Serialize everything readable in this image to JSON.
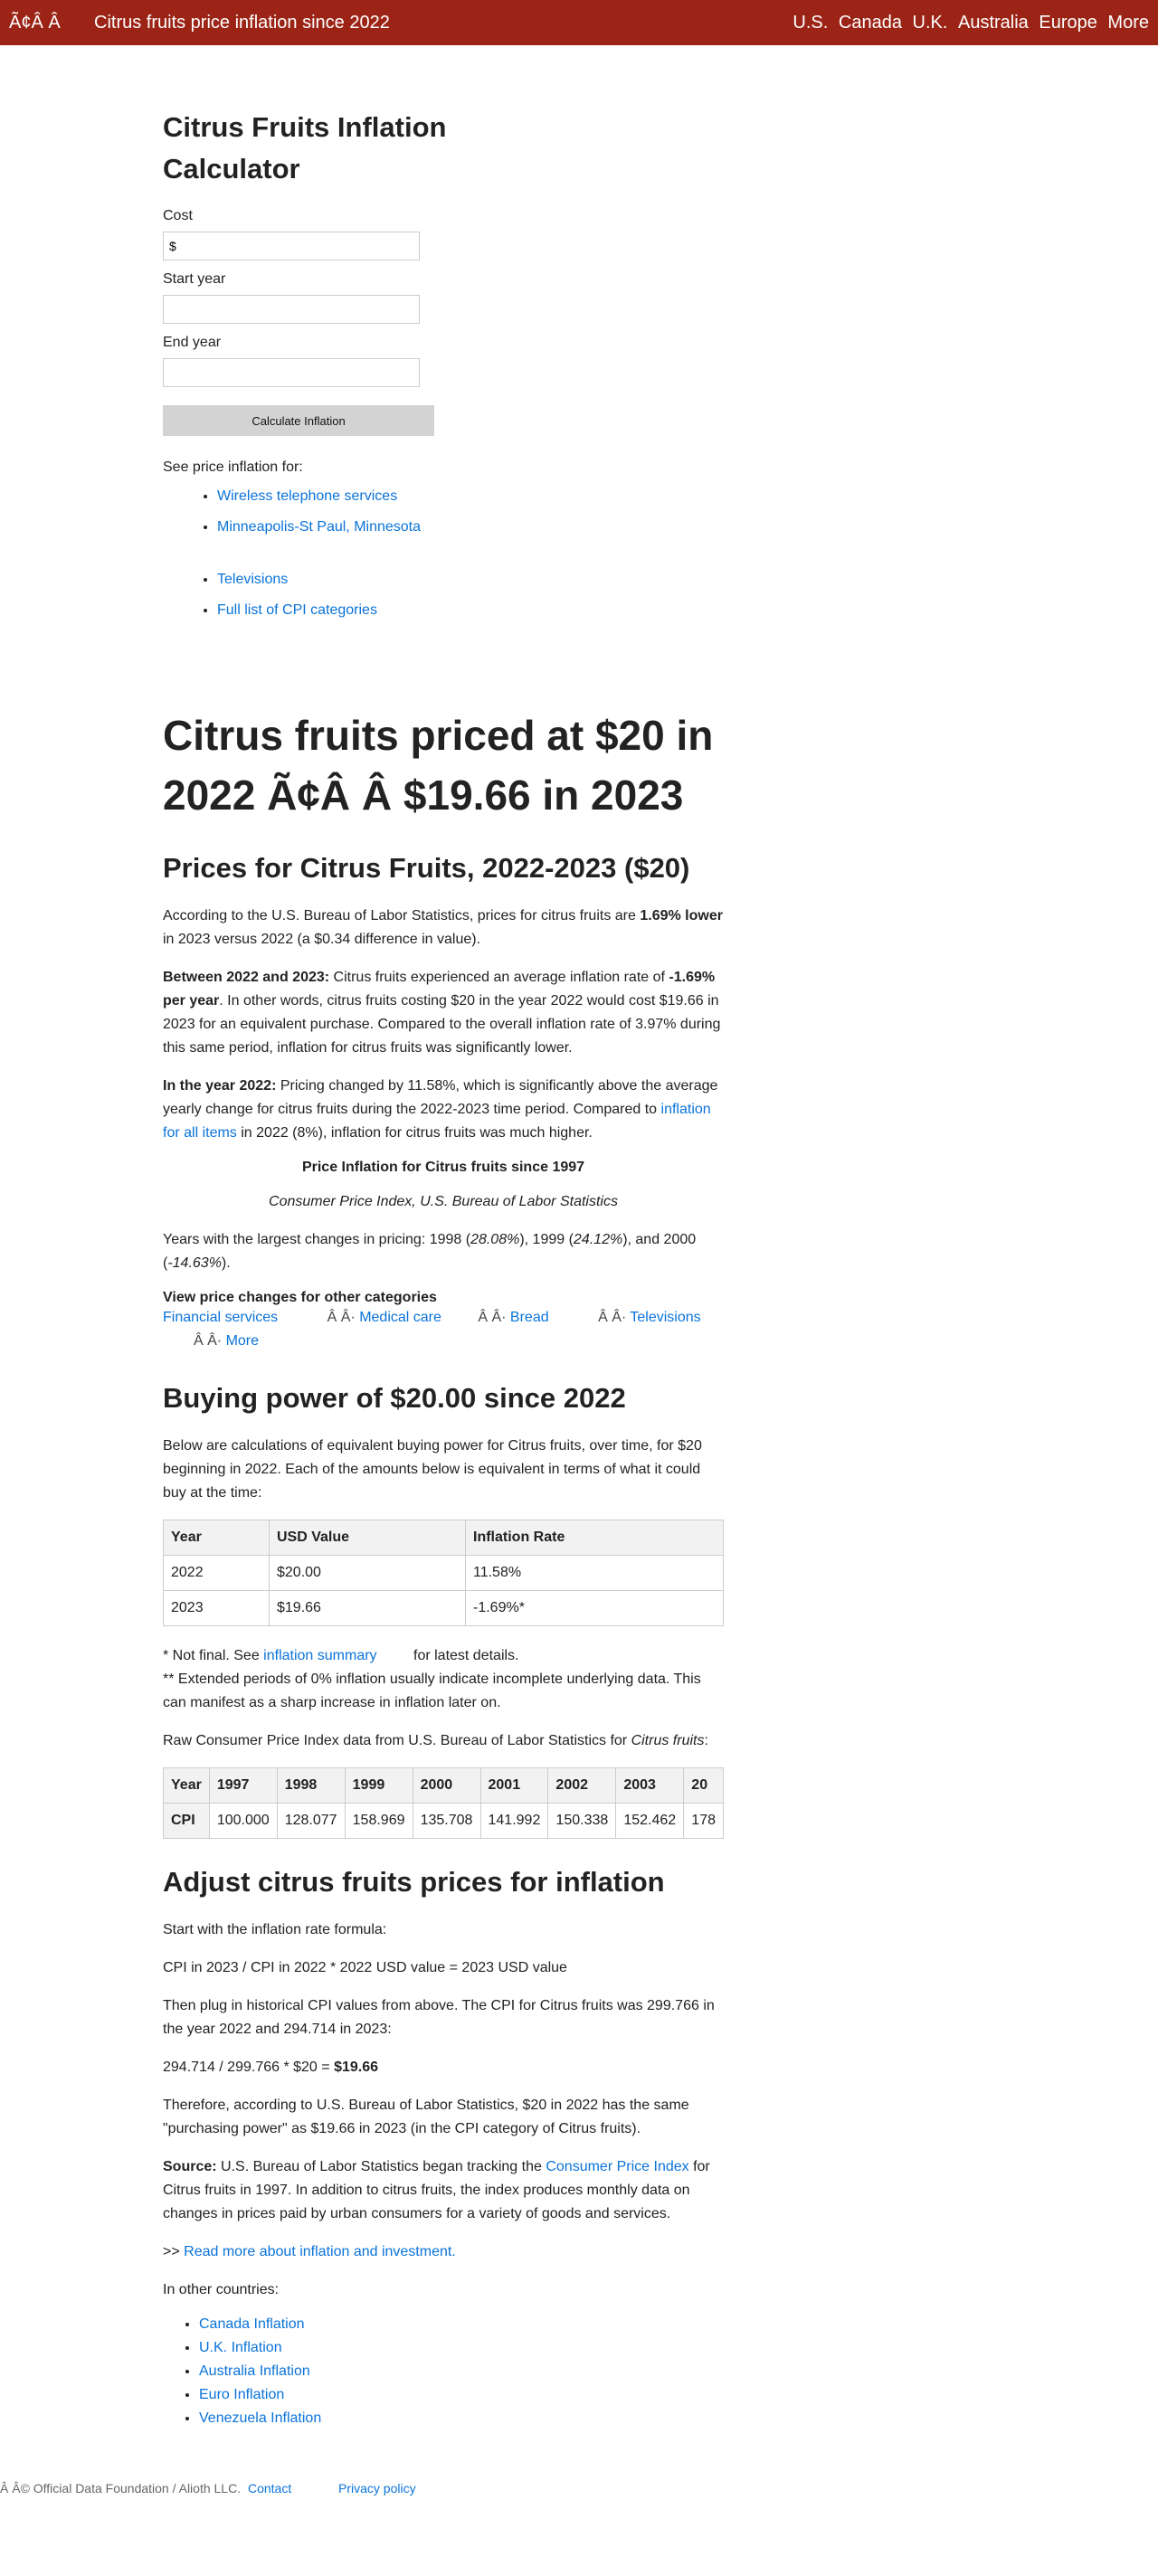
{
  "header": {
    "brand": "Ã¢Â Â",
    "title": "Citrus fruits price inflation since 2022",
    "nav": [
      "U.S.",
      "Canada",
      "U.K.",
      "Australia",
      "Europe",
      "More"
    ]
  },
  "calculator": {
    "title": "Citrus Fruits Inflation Calculator",
    "cost_label": "Cost",
    "cost_value": "$",
    "start_label": "Start year",
    "start_value": "",
    "end_label": "End year",
    "end_value": "",
    "button": "Calculate Inflation",
    "see_text": "See price inflation for:",
    "links_a": [
      "Wireless telephone services",
      "Minneapolis-St Paul, Minnesota"
    ],
    "links_b": [
      "Televisions",
      "Full list of CPI categories"
    ]
  },
  "article": {
    "headline": "Citrus fruits priced at $20 in 2022 Ã¢Â Â $19.66 in 2023",
    "prices_heading": "Prices for Citrus Fruits, 2022-2023 ($20)",
    "p1_pre": "According to the U.S. Bureau of Labor Statistics, prices for citrus fruits are ",
    "p1_bold": "1.69% lower",
    "p1_post": " in 2023 versus 2022 (a $0.34 difference in value).",
    "p2_bold1": "Between 2022 and 2023:",
    "p2_mid": " Citrus fruits experienced an average inflation rate of ",
    "p2_bold2": "-1.69% per year",
    "p2_post": ". In other words, citrus fruits costing $20 in the year 2022 would cost $19.66 in 2023 for an equivalent purchase. Compared to the overall inflation rate of 3.97% during this same period, inflation for citrus fruits was significantly lower.",
    "p3_bold": "In the year 2022:",
    "p3_mid": " Pricing changed by 11.58%, which is significantly above the average yearly change for citrus fruits during the 2022-2023 time period. Compared to ",
    "p3_link": "inflation for all items",
    "p3_post": " in 2022 (8%), inflation for citrus fruits was much higher.",
    "chart_title": "Price Inflation for Citrus fruits since 1997",
    "chart_subtitle": "Consumer Price Index, U.S. Bureau of Labor Statistics",
    "largest_pre": "Years with the largest changes in pricing: 1998 (",
    "largest_v1": "28.08%",
    "largest_mid1": "), 1999 (",
    "largest_v2": "24.12%",
    "largest_mid2": "), and 2000 (",
    "largest_v3": "-14.63%",
    "largest_post": ").",
    "view_title": "View price changes for other categories",
    "view_sep": "Â Â·",
    "view_links": [
      "Financial services",
      "Medical care",
      "Bread",
      "Televisions",
      "More"
    ]
  },
  "buying_power": {
    "heading": "Buying power of $20.00 since 2022",
    "intro": "Below are calculations of equivalent buying power for Citrus fruits, over time, for $20 beginning in 2022. Each of the amounts below is equivalent in terms of what it could buy at the time:",
    "columns": [
      "Year",
      "USD Value",
      "Inflation Rate"
    ],
    "rows": [
      [
        "2022",
        "$20.00",
        "11.58%"
      ],
      [
        "2023",
        "$19.66",
        "-1.69%*"
      ]
    ],
    "note1_pre": "* Not final. See ",
    "note1_link": "inflation summary",
    "note1_post": " for latest details.",
    "note2": "** Extended periods of 0% inflation usually indicate incomplete underlying data. This can manifest as a sharp increase in inflation later on.",
    "raw_pre": "Raw Consumer Price Index data from U.S. Bureau of Labor Statistics for ",
    "raw_ital": "Citrus fruits",
    "raw_post": ":",
    "raw_header": [
      "Year",
      "1997",
      "1998",
      "1999",
      "2000",
      "2001",
      "2002",
      "2003",
      "20"
    ],
    "raw_row": [
      "CPI",
      "100.000",
      "128.077",
      "158.969",
      "135.708",
      "141.992",
      "150.338",
      "152.462",
      "178"
    ]
  },
  "adjust": {
    "heading": "Adjust citrus fruits prices for inflation",
    "p1": "Start with the inflation rate formula:",
    "formula": "CPI in 2023 / CPI in 2022 * 2022 USD value = 2023 USD value",
    "p2": "Then plug in historical CPI values from above. The CPI for Citrus fruits was 299.766 in the year 2022 and 294.714 in 2023:",
    "calc_pre": "294.714 / 299.766 * $20 = ",
    "calc_bold": "$19.66",
    "p3": "Therefore, according to U.S. Bureau of Labor Statistics, $20 in 2022 has the same \"purchasing power\" as $19.66 in 2023 (in the CPI category of Citrus fruits).",
    "src_bold": "Source:",
    "src_mid": " U.S. Bureau of Labor Statistics began tracking the ",
    "src_link": "Consumer Price Index",
    "src_post": " for Citrus fruits in 1997. In addition to citrus fruits, the index produces monthly data on changes in prices paid by urban consumers for a variety of goods and services.",
    "readmore_pre": ">> ",
    "readmore_link": "Read more about inflation and investment.",
    "other_label": "In other countries:",
    "countries": [
      "Canada Inflation",
      "U.K. Inflation",
      "Australia Inflation",
      "Euro Inflation",
      "Venezuela Inflation"
    ]
  },
  "footer": {
    "copyright": "Â Â© Official Data Foundation / Alioth LLC.",
    "contact": "Contact",
    "privacy": "Privacy policy"
  }
}
